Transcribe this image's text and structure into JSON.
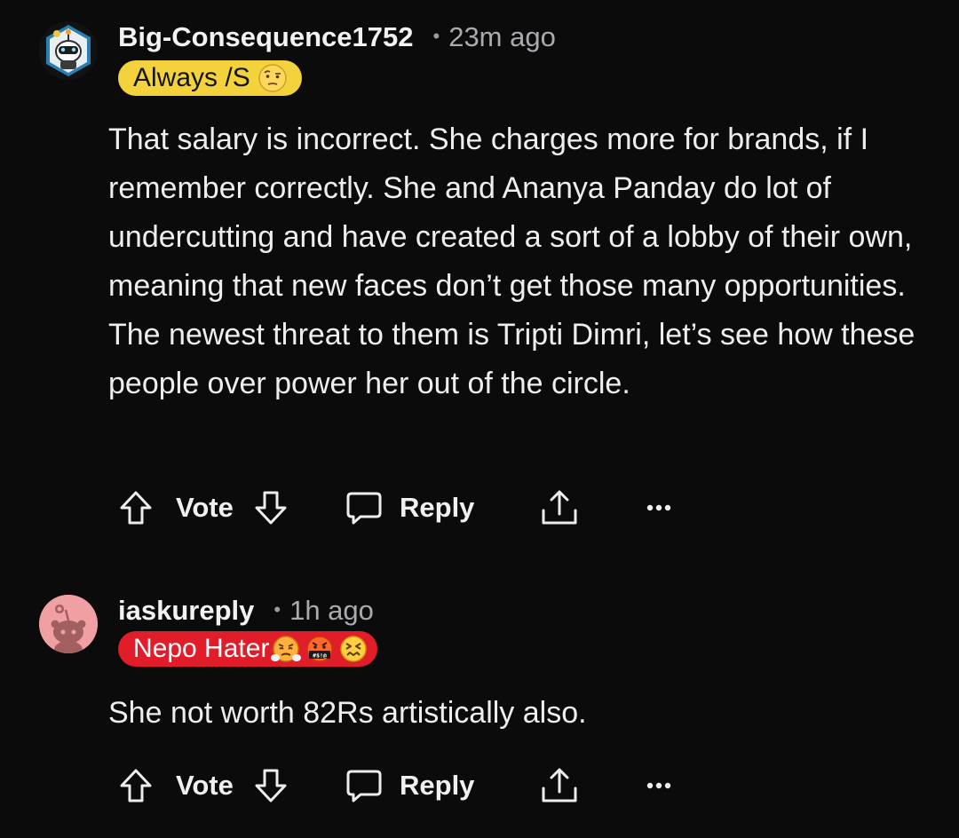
{
  "comments": [
    {
      "username": "Big-Consequence1752",
      "separator": "•",
      "time": "23m ago",
      "flair": {
        "text": "Always /S",
        "emoji_icons": [
          "raised-eyebrow-emoji-icon"
        ],
        "color": "#f3d23c"
      },
      "avatar_icon": "snoo-robot-avatar-icon",
      "body": "That salary is incorrect. She charges more for brands, if I remember correctly. She and Ananya Panday do lot of undercutting and have created a sort of a lobby of their own, meaning that new faces don’t get those many opportunities. The newest threat to them is Tripti Dimri, let’s see how these people over power her out of the circle.",
      "actions": {
        "vote_label": "Vote",
        "reply_label": "Reply",
        "upvote_icon": "arrow-up-icon",
        "downvote_icon": "arrow-down-icon",
        "reply_icon": "speech-bubble-icon",
        "share_icon": "share-icon",
        "more_icon": "more-dots-icon"
      }
    },
    {
      "username": "iaskureply",
      "separator": "•",
      "time": "1h ago",
      "flair": {
        "text": "Nepo Hater",
        "emoji_icons": [
          "steam-nose-emoji-icon",
          "cursing-face-emoji-icon",
          "confounded-face-emoji-icon"
        ],
        "emoji_text": "#$!@",
        "color": "#e11d2a"
      },
      "avatar_icon": "default-snoo-avatar-icon",
      "body": "She not worth 82Rs artistically also.",
      "actions": {
        "vote_label": "Vote",
        "reply_label": "Reply",
        "upvote_icon": "arrow-up-icon",
        "downvote_icon": "arrow-down-icon",
        "reply_icon": "speech-bubble-icon",
        "share_icon": "share-icon",
        "more_icon": "more-dots-icon"
      }
    }
  ],
  "theme": {
    "background": "#0b0b0c",
    "text": "#eeeeef",
    "muted": "#a9abaf"
  }
}
